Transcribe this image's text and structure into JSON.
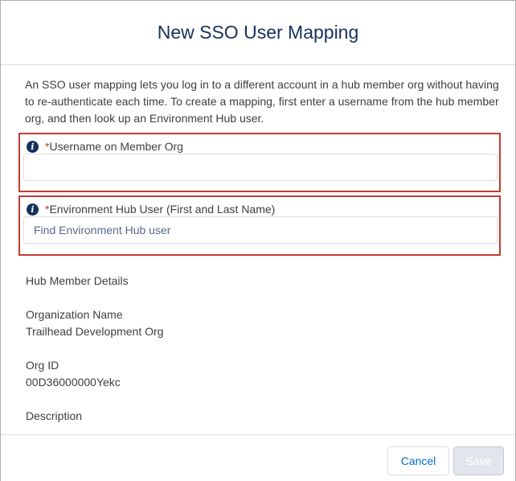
{
  "dialog": {
    "title": "New SSO User Mapping",
    "intro": "An SSO user mapping lets you log in to a different account in a hub member org without having to re-authenticate each time. To create a mapping, first enter a username from the hub member org, and then look up an Environment Hub user."
  },
  "fields": {
    "username": {
      "required_mark": "*",
      "label": "Username on Member Org",
      "value": "",
      "placeholder": ""
    },
    "hub_user": {
      "required_mark": "*",
      "label": "Environment Hub User (First and Last Name)",
      "value": "",
      "placeholder": "Find Environment Hub user"
    }
  },
  "details": {
    "section_title": "Hub Member Details",
    "org_name_label": "Organization Name",
    "org_name_value": "Trailhead Development Org",
    "org_id_label": "Org ID",
    "org_id_value": "00D36000000Yekc",
    "description_label": "Description"
  },
  "footer": {
    "cancel_label": "Cancel",
    "save_label": "Save"
  },
  "icons": {
    "info": "info-icon",
    "info_glyph": "i"
  },
  "colors": {
    "title": "#16325c",
    "error_border": "#c23934",
    "link_blue": "#0070d2",
    "disabled_button": "#e0e5ee"
  }
}
